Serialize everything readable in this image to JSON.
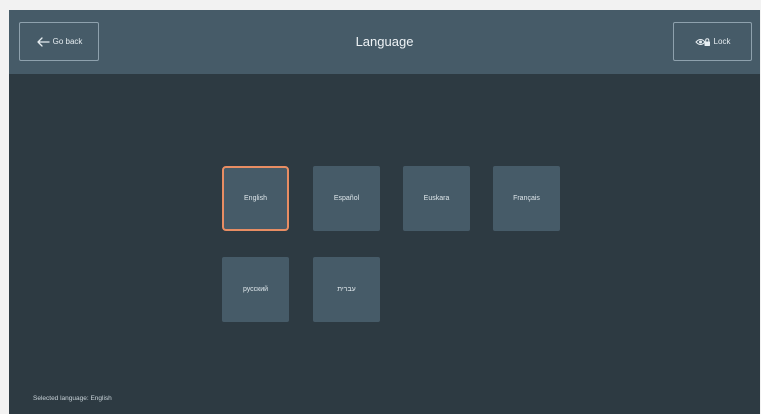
{
  "header": {
    "title": "Language",
    "back_label": "Go back",
    "lock_label": "Lock"
  },
  "languages": [
    {
      "label": "English",
      "selected": true
    },
    {
      "label": "Español",
      "selected": false
    },
    {
      "label": "Euskara",
      "selected": false
    },
    {
      "label": "Français",
      "selected": false
    },
    {
      "label": "русский",
      "selected": false
    },
    {
      "label": "עברית",
      "selected": false
    }
  ],
  "status": {
    "text": "Selected language: English"
  },
  "colors": {
    "background": "#2d3a42",
    "header": "#465b68",
    "tile": "#465b68",
    "selected_border": "#e88d63"
  },
  "icons": {
    "back": "arrow-left-icon",
    "lock": "eye-lock-icon"
  }
}
